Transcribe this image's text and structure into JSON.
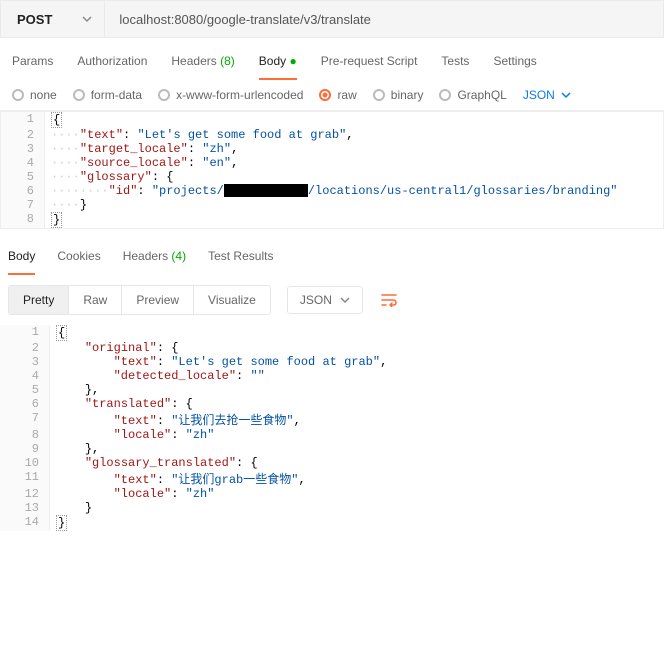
{
  "request": {
    "method": "POST",
    "url": "localhost:8080/google-translate/v3/translate"
  },
  "tabs": {
    "params": "Params",
    "auth": "Authorization",
    "headers": "Headers",
    "headers_count": "(8)",
    "body": "Body",
    "prerequest": "Pre-request Script",
    "tests": "Tests",
    "settings": "Settings"
  },
  "body_radios": {
    "none": "none",
    "formdata": "form-data",
    "xform": "x-www-form-urlencoded",
    "raw": "raw",
    "binary": "binary",
    "graphql": "GraphQL",
    "json": "JSON"
  },
  "req_body": {
    "l2_key": "\"text\"",
    "l2_val": "\"Let's get some food at grab\"",
    "l3_key": "\"target_locale\"",
    "l3_val": "\"zh\"",
    "l4_key": "\"source_locale\"",
    "l4_val": "\"en\"",
    "l5_key": "\"glossary\"",
    "l6_key": "\"id\"",
    "l6_val_a": "\"projects/",
    "l6_val_b": "/locations/us-central1/glossaries/branding\""
  },
  "resp_tabs": {
    "body": "Body",
    "cookies": "Cookies",
    "headers": "Headers",
    "headers_count": "(4)",
    "testresults": "Test Results"
  },
  "view": {
    "pretty": "Pretty",
    "raw": "Raw",
    "preview": "Preview",
    "visualize": "Visualize",
    "json": "JSON"
  },
  "resp_body": {
    "l2_key": "\"original\"",
    "l3_key": "\"text\"",
    "l3_val": "\"Let's get some food at grab\"",
    "l4_key": "\"detected_locale\"",
    "l4_val": "\"\"",
    "l6_key": "\"translated\"",
    "l7_key": "\"text\"",
    "l7_val": "\"让我们去抢一些食物\"",
    "l8_key": "\"locale\"",
    "l8_val": "\"zh\"",
    "l10_key": "\"glossary_translated\"",
    "l11_key": "\"text\"",
    "l11_val": "\"让我们grab一些食物\"",
    "l12_key": "\"locale\"",
    "l12_val": "\"zh\""
  }
}
